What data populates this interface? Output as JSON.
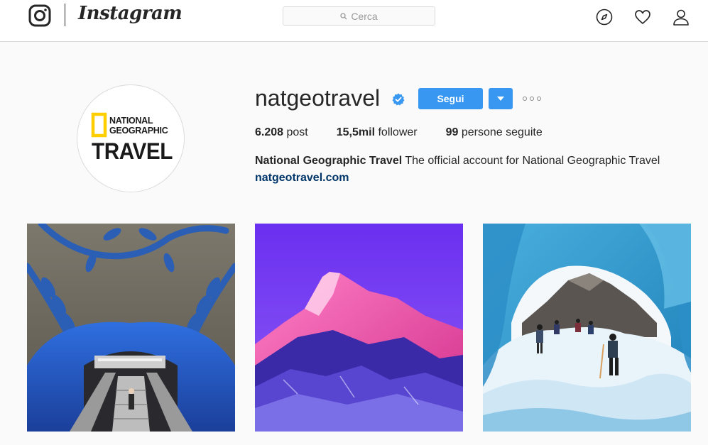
{
  "nav": {
    "wordmark": "Instagram",
    "search_placeholder": "Cerca",
    "icons": [
      "instagram-logo-icon",
      "search-icon",
      "compass-icon",
      "heart-icon",
      "person-icon"
    ]
  },
  "profile": {
    "username": "natgeotravel",
    "verified": true,
    "follow_label": "Segui",
    "avatar_logo": {
      "line1": "NATIONAL",
      "line2": "GEOGRAPHIC",
      "line3": "TRAVEL"
    },
    "stats": [
      {
        "value": "6.208",
        "label": "post"
      },
      {
        "value": "15,5mil",
        "label": "follower"
      },
      {
        "value": "99",
        "label": "persone seguite"
      }
    ],
    "bio_name": "National Geographic Travel",
    "bio_text": "The official account for National Geographic Travel",
    "website": "natgeotravel.com"
  },
  "posts": [
    {
      "name": "subway-station-post"
    },
    {
      "name": "mountain-sunset-post"
    },
    {
      "name": "ice-cave-hikers-post"
    }
  ],
  "colors": {
    "accent": "#3897f0",
    "link": "#003569",
    "natgeo_yellow": "#ffce00"
  }
}
